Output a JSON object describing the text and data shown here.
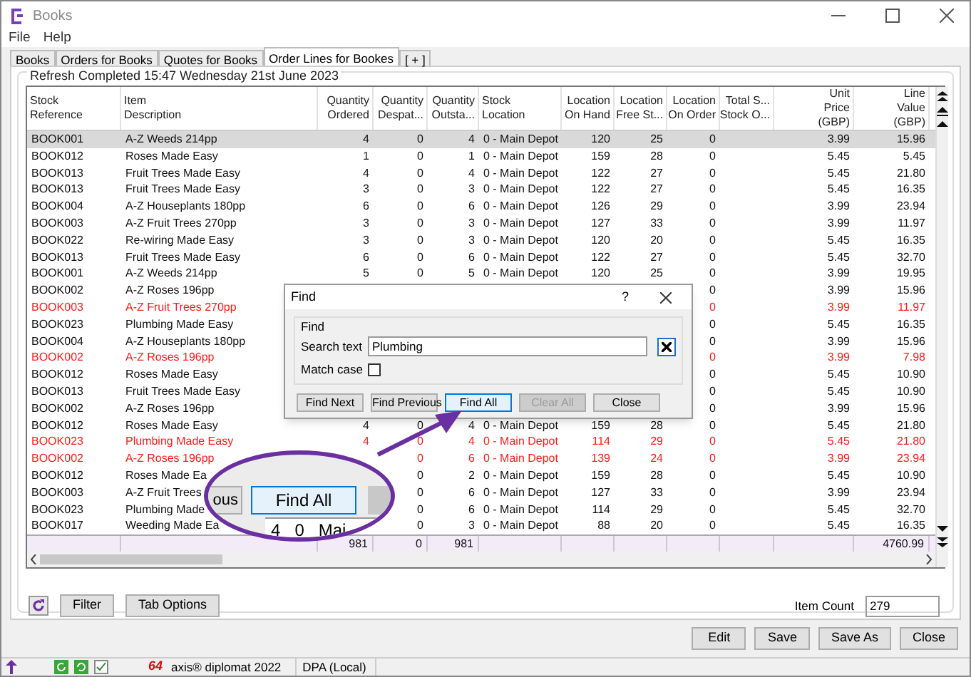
{
  "window": {
    "title": "Books"
  },
  "menu": [
    "File",
    "Help"
  ],
  "tabs": [
    {
      "label": "Books",
      "selected": false
    },
    {
      "label": "Orders for Books",
      "selected": false
    },
    {
      "label": "Quotes for Books",
      "selected": false
    },
    {
      "label": "Order Lines for Bookes",
      "selected": true
    },
    {
      "label": "[ + ]",
      "selected": false
    }
  ],
  "refresh_status": "Refresh Completed 15:47 Wednesday 21st June 2023",
  "table": {
    "columns": [
      {
        "lines": [
          "Stock",
          "Reference"
        ],
        "kind": "text"
      },
      {
        "lines": [
          "Item",
          "Description"
        ],
        "kind": "text"
      },
      {
        "lines": [
          "Quantity",
          "Ordered"
        ],
        "kind": "number"
      },
      {
        "lines": [
          "Quantity",
          "Despat..."
        ],
        "kind": "number"
      },
      {
        "lines": [
          "Quantity",
          "Outsta..."
        ],
        "kind": "number"
      },
      {
        "lines": [
          "Stock",
          "Location"
        ],
        "kind": "text"
      },
      {
        "lines": [
          "Location",
          "On Hand"
        ],
        "kind": "number"
      },
      {
        "lines": [
          "Location",
          "Free St..."
        ],
        "kind": "number"
      },
      {
        "lines": [
          "Location",
          "On Order"
        ],
        "kind": "number"
      },
      {
        "lines": [
          "Total S...",
          "Stock O..."
        ],
        "kind": "number"
      },
      {
        "lines": [
          "Unit",
          "Price",
          "(GBP)"
        ],
        "kind": "number"
      },
      {
        "lines": [
          "Line",
          "Value",
          "(GBP)"
        ],
        "kind": "number"
      }
    ],
    "rows": [
      {
        "selected": true,
        "flagged": false,
        "cells": [
          "BOOK001",
          "A-Z Weeds 214pp",
          "4",
          "0",
          "4",
          "0 - Main Depot",
          "120",
          "25",
          "0",
          null,
          "3.99",
          "15.96"
        ]
      },
      {
        "selected": false,
        "flagged": false,
        "cells": [
          "BOOK012",
          "Roses Made Easy",
          "1",
          "0",
          "1",
          "0 - Main Depot",
          "159",
          "28",
          "0",
          null,
          "5.45",
          "5.45"
        ]
      },
      {
        "selected": false,
        "flagged": false,
        "cells": [
          "BOOK013",
          "Fruit Trees Made Easy",
          "4",
          "0",
          "4",
          "0 - Main Depot",
          "122",
          "27",
          "0",
          null,
          "5.45",
          "21.80"
        ]
      },
      {
        "selected": false,
        "flagged": false,
        "cells": [
          "BOOK013",
          "Fruit Trees Made Easy",
          "3",
          "0",
          "3",
          "0 - Main Depot",
          "122",
          "27",
          "0",
          null,
          "5.45",
          "16.35"
        ]
      },
      {
        "selected": false,
        "flagged": false,
        "cells": [
          "BOOK004",
          "A-Z Houseplants 180pp",
          "6",
          "0",
          "6",
          "0 - Main Depot",
          "126",
          "29",
          "0",
          null,
          "3.99",
          "23.94"
        ]
      },
      {
        "selected": false,
        "flagged": false,
        "cells": [
          "BOOK003",
          "A-Z Fruit Trees 270pp",
          "3",
          "0",
          "3",
          "0 - Main Depot",
          "127",
          "33",
          "0",
          null,
          "3.99",
          "11.97"
        ]
      },
      {
        "selected": false,
        "flagged": false,
        "cells": [
          "BOOK022",
          "Re-wiring Made Easy",
          "3",
          "0",
          "3",
          "0 - Main Depot",
          "120",
          "20",
          "0",
          null,
          "5.45",
          "16.35"
        ]
      },
      {
        "selected": false,
        "flagged": false,
        "cells": [
          "BOOK013",
          "Fruit Trees Made Easy",
          "6",
          "0",
          "6",
          "0 - Main Depot",
          "122",
          "27",
          "0",
          null,
          "5.45",
          "32.70"
        ]
      },
      {
        "selected": false,
        "flagged": false,
        "cells": [
          "BOOK001",
          "A-Z Weeds 214pp",
          "5",
          "0",
          "5",
          "0 - Main Depot",
          "120",
          "25",
          "0",
          null,
          "3.99",
          "19.95"
        ]
      },
      {
        "selected": false,
        "flagged": false,
        "cells": [
          "BOOK002",
          "A-Z Roses 196pp",
          null,
          null,
          null,
          null,
          null,
          null,
          "0",
          null,
          "3.99",
          "15.96"
        ]
      },
      {
        "selected": false,
        "flagged": true,
        "cells": [
          "BOOK003",
          "A-Z Fruit Trees 270pp",
          null,
          null,
          null,
          null,
          null,
          null,
          "0",
          null,
          "3.99",
          "11.97"
        ]
      },
      {
        "selected": false,
        "flagged": false,
        "cells": [
          "BOOK023",
          "Plumbing Made Easy",
          null,
          null,
          null,
          null,
          null,
          null,
          "0",
          null,
          "5.45",
          "16.35"
        ]
      },
      {
        "selected": false,
        "flagged": false,
        "cells": [
          "BOOK004",
          "A-Z Houseplants 180pp",
          null,
          null,
          null,
          null,
          null,
          null,
          "0",
          null,
          "3.99",
          "15.96"
        ]
      },
      {
        "selected": false,
        "flagged": true,
        "cells": [
          "BOOK002",
          "A-Z Roses 196pp",
          null,
          null,
          null,
          null,
          null,
          null,
          "0",
          null,
          "3.99",
          "7.98"
        ]
      },
      {
        "selected": false,
        "flagged": false,
        "cells": [
          "BOOK012",
          "Roses Made Easy",
          null,
          null,
          null,
          null,
          null,
          null,
          "0",
          null,
          "5.45",
          "10.90"
        ]
      },
      {
        "selected": false,
        "flagged": false,
        "cells": [
          "BOOK013",
          "Fruit Trees Made Easy",
          null,
          null,
          null,
          null,
          null,
          null,
          "0",
          null,
          "5.45",
          "10.90"
        ]
      },
      {
        "selected": false,
        "flagged": false,
        "cells": [
          "BOOK002",
          "A-Z Roses 196pp",
          null,
          null,
          null,
          null,
          null,
          null,
          "0",
          null,
          "3.99",
          "15.96"
        ]
      },
      {
        "selected": false,
        "flagged": false,
        "cells": [
          "BOOK012",
          "Roses Made Easy",
          "4",
          "0",
          "4",
          "0 - Main Depot",
          "159",
          "28",
          "0",
          null,
          "5.45",
          "21.80"
        ]
      },
      {
        "selected": false,
        "flagged": true,
        "cells": [
          "BOOK023",
          "Plumbing Made Easy",
          "4",
          "0",
          "4",
          "0 - Main Depot",
          "114",
          "29",
          "0",
          null,
          "5.45",
          "21.80"
        ]
      },
      {
        "selected": false,
        "flagged": true,
        "cells": [
          "BOOK002",
          "A-Z Roses 196pp",
          null,
          "0",
          "6",
          "0 - Main Depot",
          "139",
          "24",
          "0",
          null,
          "3.99",
          "23.94"
        ]
      },
      {
        "selected": false,
        "flagged": false,
        "cells": [
          "BOOK012",
          "Roses Made Ea",
          null,
          "0",
          "2",
          "0 - Main Depot",
          "159",
          "28",
          "0",
          null,
          "5.45",
          "10.90"
        ]
      },
      {
        "selected": false,
        "flagged": false,
        "cells": [
          "BOOK003",
          "A-Z Fruit Trees",
          null,
          "0",
          "6",
          "0 - Main Depot",
          "127",
          "33",
          "0",
          null,
          "3.99",
          "23.94"
        ]
      },
      {
        "selected": false,
        "flagged": false,
        "cells": [
          "BOOK023",
          "Plumbing Made",
          null,
          "0",
          "6",
          "0 - Main Depot",
          "114",
          "29",
          "0",
          null,
          "5.45",
          "32.70"
        ]
      },
      {
        "selected": false,
        "flagged": false,
        "cells": [
          "BOOK017",
          "Weeding Made Ea",
          null,
          "0",
          "3",
          "0 - Main Depot",
          "88",
          "20",
          "0",
          null,
          "5.45",
          "16.35"
        ]
      }
    ],
    "totals": {
      "quantity_ordered": "981",
      "quantity_despatched": "0",
      "quantity_outstanding": "981",
      "line_value": "4760.99"
    }
  },
  "panel_buttons": [
    "Filter",
    "Tab Options"
  ],
  "item_count": {
    "label": "Item Count",
    "value": "279"
  },
  "footer_buttons": [
    "Edit",
    "Save",
    "Save As",
    "Close"
  ],
  "status_bar": {
    "logo_text": "64",
    "product": "axis® diplomat 2022",
    "connection": "DPA (Local)"
  },
  "find_dialog": {
    "title": "Find",
    "help": "?",
    "group": "Find",
    "search_label": "Search text",
    "search_value": "Plumbing",
    "match_case_label": "Match case",
    "match_case": false,
    "buttons": [
      {
        "label": "Find Next",
        "focused": false,
        "disabled": false
      },
      {
        "label": "Find Previous",
        "focused": false,
        "disabled": false
      },
      {
        "label": "Find All",
        "focused": true,
        "disabled": false
      },
      {
        "label": "Clear All",
        "focused": false,
        "disabled": true
      },
      {
        "label": "Close",
        "focused": false,
        "disabled": false
      }
    ]
  },
  "callout": {
    "left_button": "ous",
    "button": "Find All",
    "row_texts": [
      "4",
      "0",
      "Mai"
    ]
  }
}
